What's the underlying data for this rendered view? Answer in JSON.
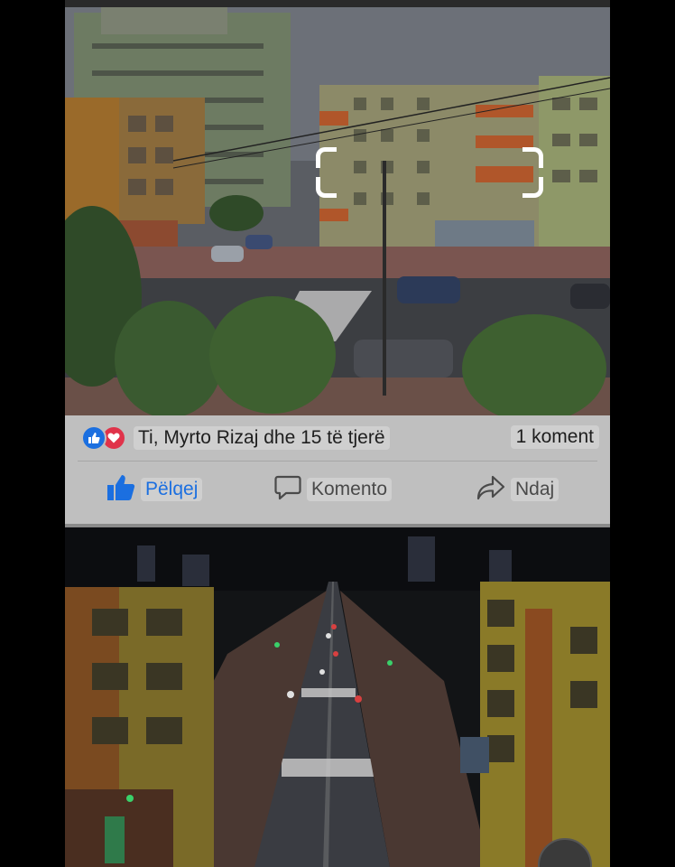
{
  "post": {
    "reactions": {
      "icons": [
        "like-icon",
        "love-icon"
      ],
      "summary": "Ti, Myrto Rizaj dhe 15 të tjerë",
      "comments": "1 koment"
    },
    "actions": {
      "like": "Pëlqej",
      "comment": "Komento",
      "share": "Ndaj"
    }
  },
  "colors": {
    "like_blue": "#1b6fe0",
    "love_red": "#e0334a",
    "bar_gray": "#bfbfbf"
  }
}
